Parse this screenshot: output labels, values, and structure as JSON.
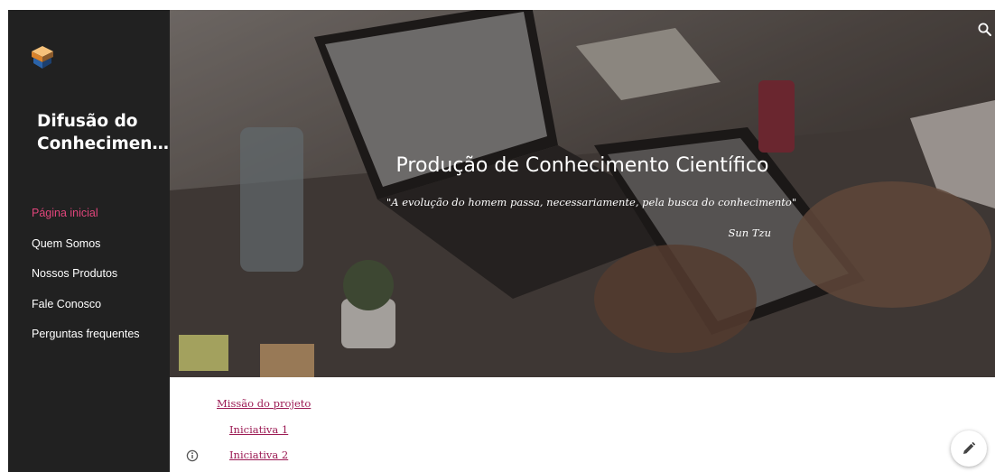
{
  "site": {
    "title": "Difusão do\nConhecimen…",
    "logo_icon": "layers-logo-icon"
  },
  "nav": {
    "items": [
      {
        "label": "Página inicial",
        "active": true
      },
      {
        "label": "Quem Somos",
        "active": false
      },
      {
        "label": "Nossos Produtos",
        "active": false
      },
      {
        "label": "Fale Conosco",
        "active": false
      },
      {
        "label": "Perguntas frequentes",
        "active": false
      }
    ]
  },
  "hero": {
    "title": "Produção de Conhecimento Científico",
    "quote": "\"A evolução do homem  passa, necessariamente, pela busca  do conhecimento\"",
    "author": "Sun Tzu"
  },
  "content": {
    "links": [
      "Missão do projeto",
      "Iniciativa 1",
      "Iniciativa 2"
    ]
  },
  "icons": {
    "search": "search-icon",
    "info": "info-icon",
    "edit": "pencil-icon"
  },
  "colors": {
    "sidebar_bg": "#212121",
    "nav_active": "#e0457b",
    "link": "#9c1b54"
  }
}
